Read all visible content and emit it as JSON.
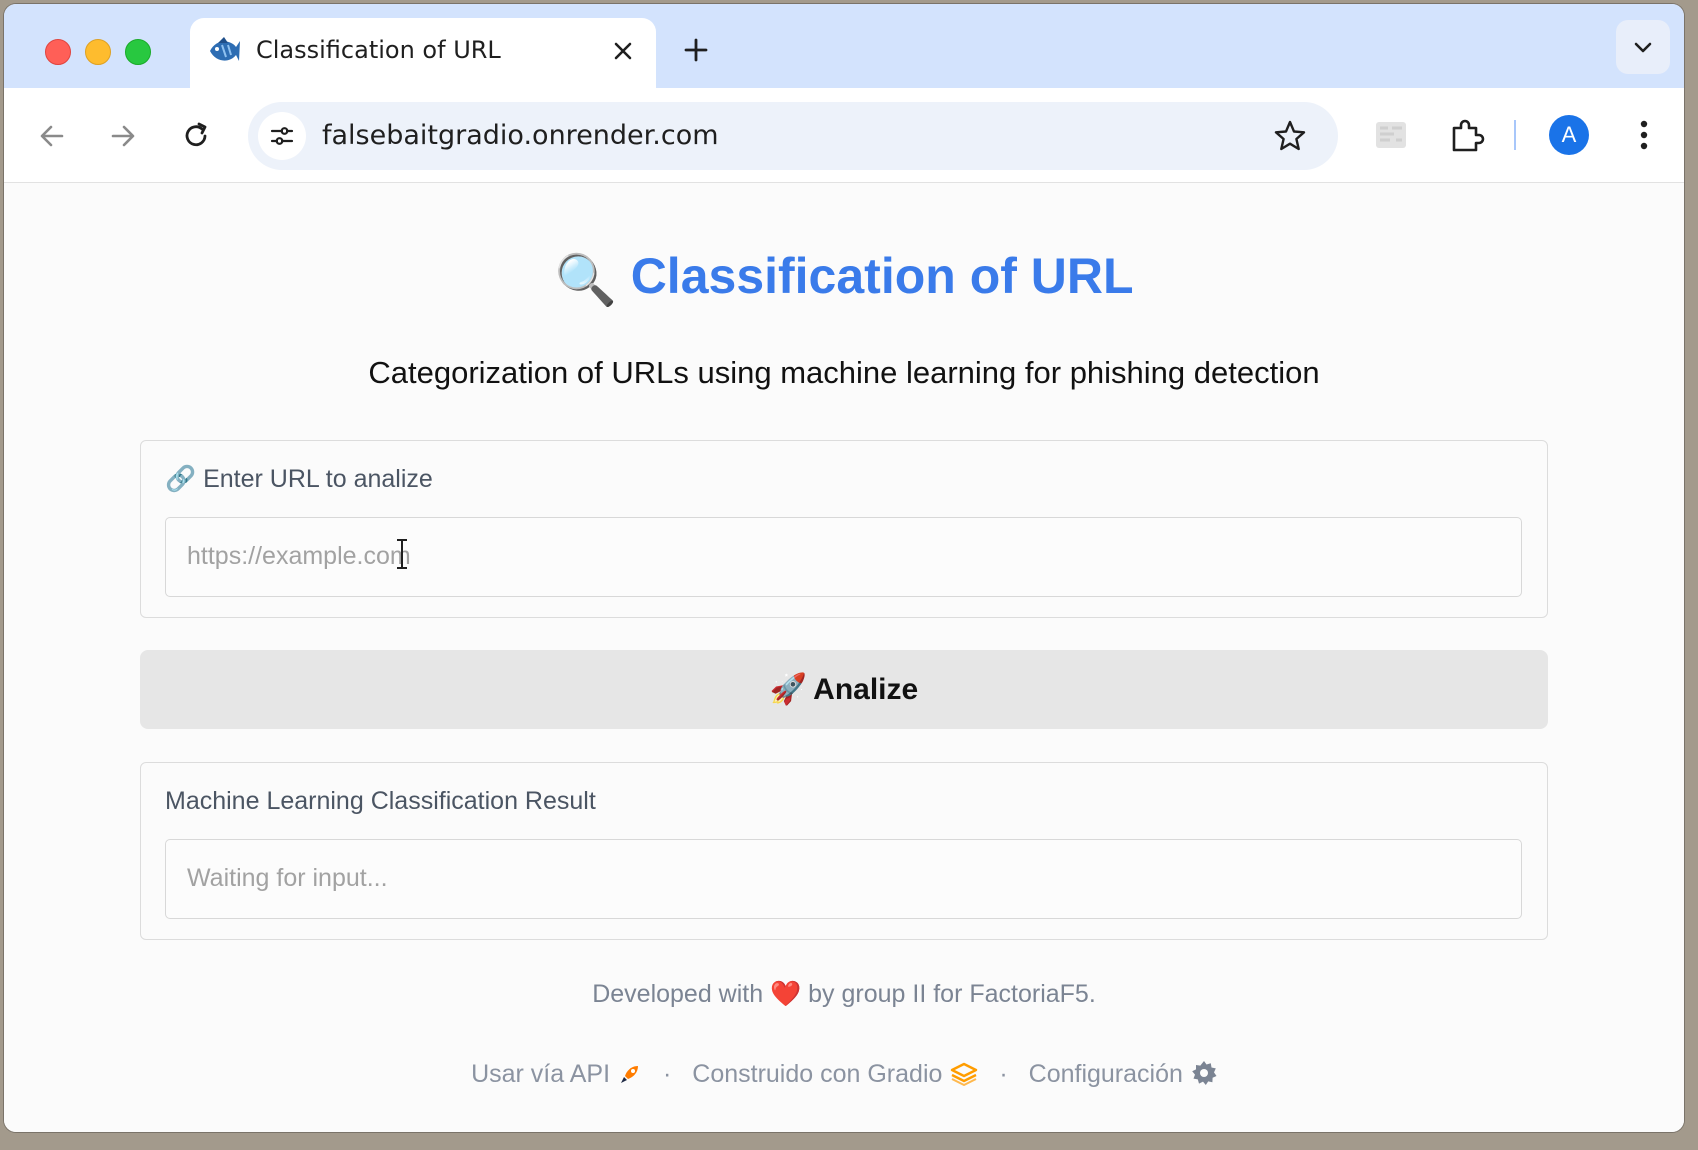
{
  "browser": {
    "tab": {
      "title": "Classification of URL"
    },
    "address_bar": {
      "url": "falsebaitgradio.onrender.com"
    },
    "profile_initial": "A"
  },
  "page": {
    "title": "Classification of URL",
    "title_emoji": "🔍",
    "subtitle": "Categorization of URLs using machine learning for phishing detection",
    "url_input": {
      "label": "🔗 Enter URL to analize",
      "placeholder": "https://example.com",
      "value": ""
    },
    "analyze_button": {
      "emoji": "🚀",
      "label": "Analize"
    },
    "result": {
      "label": "Machine Learning Classification Result",
      "placeholder": "Waiting for input..."
    },
    "footer_note": "Developed with ❤️ by group II for FactoriaF5.",
    "footer_links": {
      "api": "Usar vía API",
      "built_with": "Construido con Gradio",
      "settings": "Configuración",
      "separator": "·"
    }
  },
  "colors": {
    "title_blue": "#3a7bea",
    "tab_strip": "#d3e3fd",
    "button_bg": "#e6e6e6",
    "avatar": "#1a73e8"
  },
  "icons": [
    "fish-favicon-icon",
    "close-icon",
    "plus-icon",
    "chevron-down-icon",
    "back-icon",
    "forward-icon",
    "reload-icon",
    "tune-icon",
    "star-icon",
    "puzzle-icon",
    "kebab-icon",
    "rocket-icon",
    "gradio-logo-icon",
    "gear-icon"
  ]
}
